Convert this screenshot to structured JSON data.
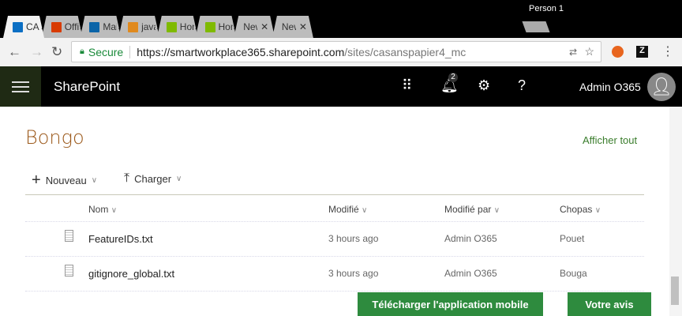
{
  "browser": {
    "profile": "Person 1",
    "tabs": [
      {
        "label": "CA",
        "color": "#0b6fc4",
        "active": true
      },
      {
        "label": "Offi",
        "color": "#d83b01"
      },
      {
        "label": "Mai",
        "color": "#0a64a8"
      },
      {
        "label": "java",
        "color": "#e08a1e"
      },
      {
        "label": "Hom",
        "color": "#7fba00"
      },
      {
        "label": "Hom",
        "color": "#7fba00"
      },
      {
        "label": "New Ta",
        "color": ""
      },
      {
        "label": "New Ta",
        "color": ""
      }
    ],
    "secure_label": "Secure",
    "url_host": "https://smartworkplace365.sharepoint.com",
    "url_path": "/sites/casanspapier4_mc"
  },
  "suitebar": {
    "app_name": "SharePoint",
    "notification_count": "2",
    "user_name": "Admin O365"
  },
  "page": {
    "title": "Bongo",
    "show_all": "Afficher tout"
  },
  "toolbar": {
    "new_label": "Nouveau",
    "upload_label": "Charger"
  },
  "columns": [
    "Nom",
    "Modifié",
    "Modifié par",
    "Chopas"
  ],
  "rows": [
    {
      "name": "FeatureIDs.txt",
      "modified": "3 hours ago",
      "modified_by": "Admin O365",
      "chopas": "Pouet"
    },
    {
      "name": "gitignore_global.txt",
      "modified": "3 hours ago",
      "modified_by": "Admin O365",
      "chopas": "Bouga"
    }
  ],
  "footer": {
    "mobile_app": "Télécharger l'application mobile",
    "feedback": "Votre avis"
  }
}
